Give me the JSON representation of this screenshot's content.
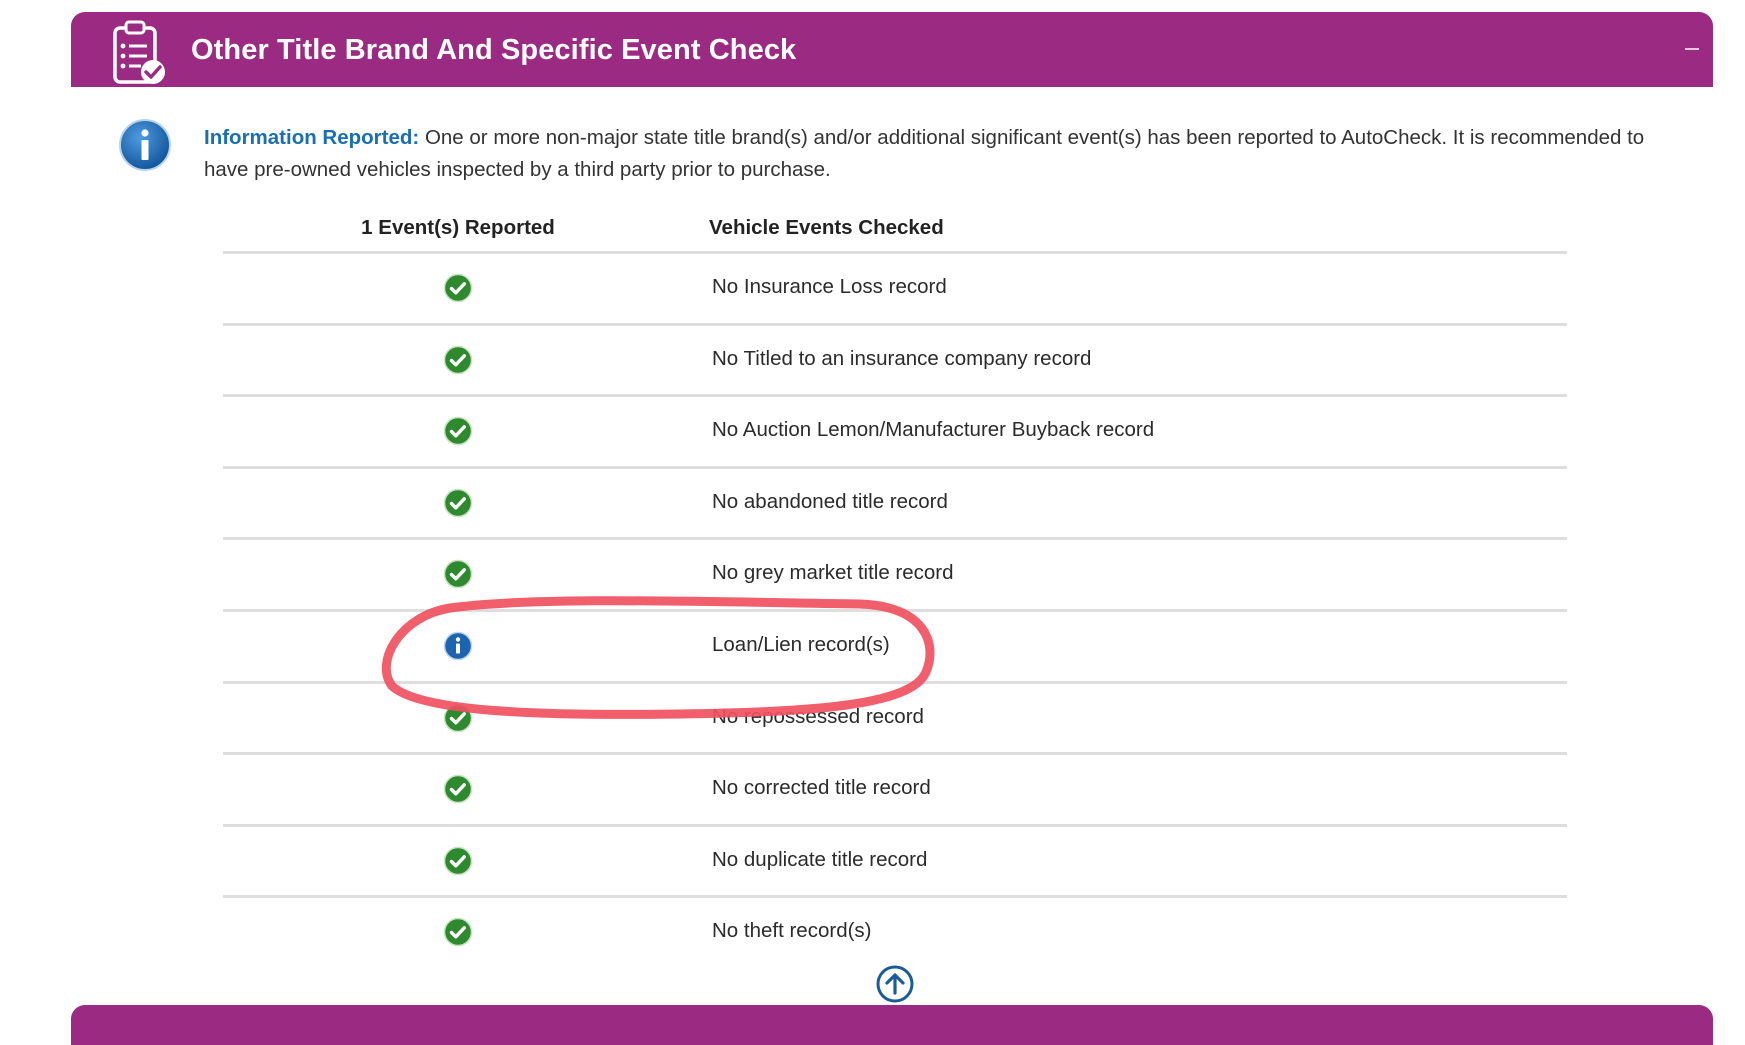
{
  "section": {
    "title": "Other Title Brand And Specific Event Check",
    "icon": "clipboard-check-icon",
    "collapse_icon": "collapse-icon",
    "accent_color": "#9b2a82"
  },
  "info": {
    "icon": "info-icon",
    "label": "Information Reported:",
    "text": "One or more non-major state title brand(s) and/or additional significant event(s) has been reported to AutoCheck. It is recommended to have pre-owned vehicles inspected by a third party prior to purchase.",
    "label_color": "#1a6fb3"
  },
  "table": {
    "headers": {
      "reported": "1 Event(s) Reported",
      "checked": "Vehicle Events Checked"
    },
    "rows": [
      {
        "status": "ok",
        "icon": "check-circle-icon",
        "text": "No Insurance Loss record"
      },
      {
        "status": "ok",
        "icon": "check-circle-icon",
        "text": "No Titled to an insurance company record"
      },
      {
        "status": "ok",
        "icon": "check-circle-icon",
        "text": "No Auction Lemon/Manufacturer Buyback record"
      },
      {
        "status": "ok",
        "icon": "check-circle-icon",
        "text": "No abandoned title record"
      },
      {
        "status": "ok",
        "icon": "check-circle-icon",
        "text": "No grey market title record"
      },
      {
        "status": "info",
        "icon": "info-circle-icon",
        "text": "Loan/Lien record(s)"
      },
      {
        "status": "ok",
        "icon": "check-circle-icon",
        "text": "No repossessed record"
      },
      {
        "status": "ok",
        "icon": "check-circle-icon",
        "text": "No corrected title record"
      },
      {
        "status": "ok",
        "icon": "check-circle-icon",
        "text": "No duplicate title record"
      },
      {
        "status": "ok",
        "icon": "check-circle-icon",
        "text": "No theft record(s)"
      }
    ]
  },
  "annotation": {
    "shape": "red-ellipse-circling-loan-lien-row",
    "color": "#f05060"
  },
  "back_to_top_icon": "arrow-up-circle-icon"
}
